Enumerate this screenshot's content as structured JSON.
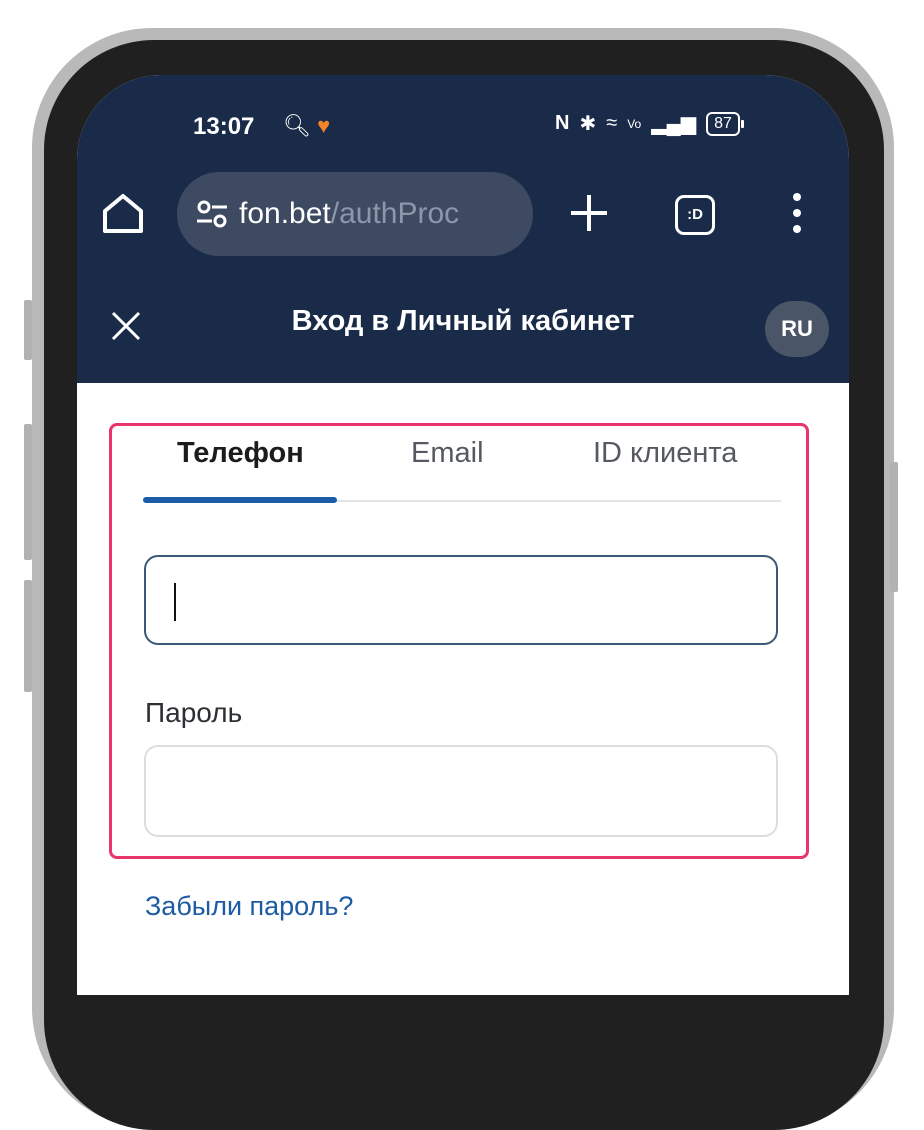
{
  "status_bar": {
    "time": "13:07",
    "battery": "87"
  },
  "browser": {
    "url_domain": "fon.bet",
    "url_path": "/authProc",
    "tabs_label": ":D"
  },
  "header": {
    "title": "Вход в Личный кабинет",
    "language": "RU"
  },
  "login": {
    "tabs": [
      "Телефон",
      "Email",
      "ID клиента"
    ],
    "password_label": "Пароль",
    "forgot_link": "Забыли пароль?"
  },
  "colors": {
    "header_bg": "#1a2a49",
    "accent": "#1b5ba8",
    "highlight": "#e8356b"
  }
}
